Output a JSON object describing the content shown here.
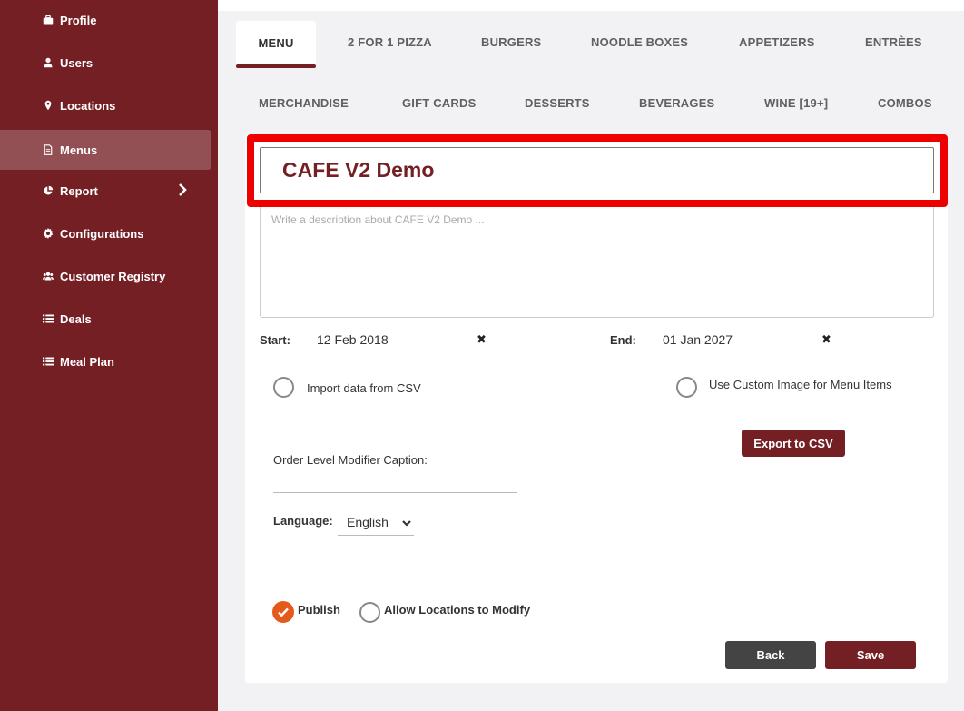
{
  "sidebar": {
    "items": [
      {
        "label": "Profile",
        "icon": "briefcase-icon"
      },
      {
        "label": "Users",
        "icon": "user-icon"
      },
      {
        "label": "Locations",
        "icon": "map-marker-icon"
      },
      {
        "label": "Menus",
        "icon": "file-icon",
        "active": true
      },
      {
        "label": "Report",
        "icon": "pie-chart-icon",
        "has_submenu": true
      },
      {
        "label": "Configurations",
        "icon": "gear-icon"
      },
      {
        "label": "Customer Registry",
        "icon": "users-icon"
      },
      {
        "label": "Deals",
        "icon": "list-icon"
      },
      {
        "label": "Meal Plan",
        "icon": "list-icon"
      }
    ]
  },
  "tabs": {
    "row1": [
      "MENU",
      "2 FOR 1 PIZZA",
      "BURGERS",
      "NOODLE BOXES",
      "APPETIZERS",
      "ENTRÈES"
    ],
    "row2": [
      "MERCHANDISE",
      "GIFT CARDS",
      "DESSERTS",
      "BEVERAGES",
      "WINE [19+]",
      "COMBOS"
    ],
    "active": "MENU"
  },
  "form": {
    "menu_name": "CAFE V2 Demo",
    "description_placeholder": "Write a description about CAFE V2 Demo ...",
    "start_label": "Start:",
    "start_value": "12 Feb 2018",
    "end_label": "End:",
    "end_value": "01 Jan 2027",
    "clear_symbol": "✖",
    "import_csv_label": "Import data from CSV",
    "custom_image_label": "Use Custom Image for Menu Items",
    "export_csv_label": "Export to CSV",
    "modifier_caption_label": "Order Level Modifier Caption:",
    "language_label": "Language:",
    "language_value": "English",
    "publish_label": "Publish",
    "publish_checked": true,
    "allow_locations_label": "Allow Locations to Modify",
    "allow_locations_checked": false,
    "back_label": "Back",
    "save_label": "Save"
  },
  "colors": {
    "sidebar_bg": "#741f24",
    "accent": "#741f24",
    "highlight": "#ee0000",
    "check": "#e55a1b"
  }
}
